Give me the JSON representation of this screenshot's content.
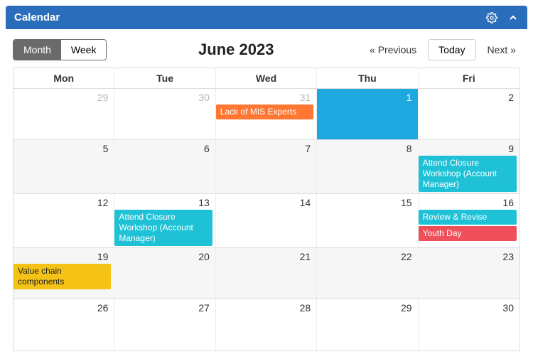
{
  "panel": {
    "title": "Calendar"
  },
  "toolbar": {
    "view_month": "Month",
    "view_week": "Week",
    "title": "June 2023",
    "prev": "« Previous",
    "today": "Today",
    "next": "Next »"
  },
  "headers": {
    "mon": "Mon",
    "tue": "Tue",
    "wed": "Wed",
    "thu": "Thu",
    "fri": "Fri"
  },
  "days": {
    "r0c0": "29",
    "r0c1": "30",
    "r0c2": "31",
    "r0c3": "1",
    "r0c4": "2",
    "r1c0": "5",
    "r1c1": "6",
    "r1c2": "7",
    "r1c3": "8",
    "r1c4": "9",
    "r2c0": "12",
    "r2c1": "13",
    "r2c2": "14",
    "r2c3": "15",
    "r2c4": "16",
    "r3c0": "19",
    "r3c1": "20",
    "r3c2": "21",
    "r3c3": "22",
    "r3c4": "23",
    "r4c0": "26",
    "r4c1": "27",
    "r4c2": "28",
    "r4c3": "29",
    "r4c4": "30"
  },
  "events": {
    "may31_mis": "Lack of MIS Experts",
    "jun9_closure": "Attend Closure Workshop (Account Manager)",
    "jun13_closure": "Attend Closure Workshop (Account Manager)",
    "jun16_review": "Review & Revise",
    "jun16_youth": "Youth Day",
    "jun19_value": "Value chain components"
  }
}
